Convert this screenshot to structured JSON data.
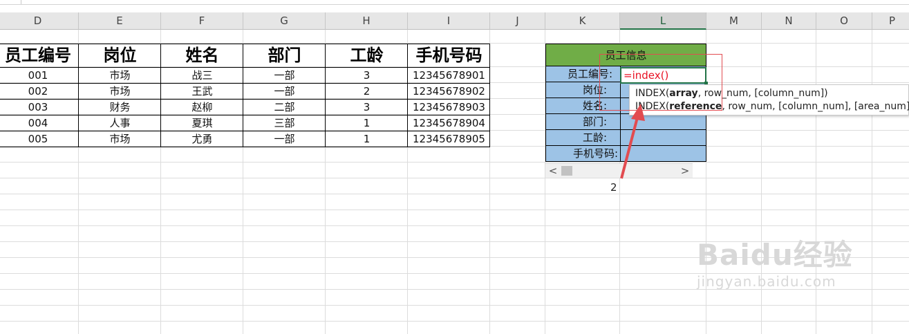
{
  "columns": [
    "D",
    "E",
    "F",
    "G",
    "H",
    "I",
    "J",
    "K",
    "L",
    "M",
    "N",
    "O",
    "P"
  ],
  "active_column": "L",
  "table": {
    "headers": [
      "员工编号",
      "岗位",
      "姓名",
      "部门",
      "工龄",
      "手机号码"
    ],
    "rows": [
      [
        "001",
        "市场",
        "战三",
        "一部",
        "3",
        "12345678901"
      ],
      [
        "002",
        "市场",
        "王武",
        "一部",
        "2",
        "12345678902"
      ],
      [
        "003",
        "财务",
        "赵柳",
        "二部",
        "3",
        "12345678903"
      ],
      [
        "004",
        "人事",
        "夏琪",
        "三部",
        "1",
        "12345678904"
      ],
      [
        "005",
        "市场",
        "尤勇",
        "一部",
        "1",
        "12345678905"
      ]
    ]
  },
  "panel": {
    "title": "员工信息",
    "labels": [
      "员工编号:",
      "岗位:",
      "姓名:",
      "部门:",
      "工龄:",
      "手机号码:"
    ],
    "formula": "=index()"
  },
  "tooltip": {
    "line1": {
      "prefix": "INDEX(",
      "bold": "array",
      "rest": ", row_num, [column_num])"
    },
    "line2": {
      "prefix": "INDEX(",
      "bold": "reference",
      "rest": ", row_num, [column_num], [area_num])"
    }
  },
  "scrollbar": {
    "left_arrow": "<",
    "right_arrow": ">"
  },
  "annotation": {
    "number": "2"
  },
  "watermark": {
    "brand": "Baidu经验",
    "url": "jingyan.baidu.com"
  },
  "colors": {
    "accent": "#217346",
    "panel_title": "#70ad47",
    "panel_rows": "#9dc3e6",
    "annotation": "#e24b50",
    "formula_text": "#e81123"
  }
}
